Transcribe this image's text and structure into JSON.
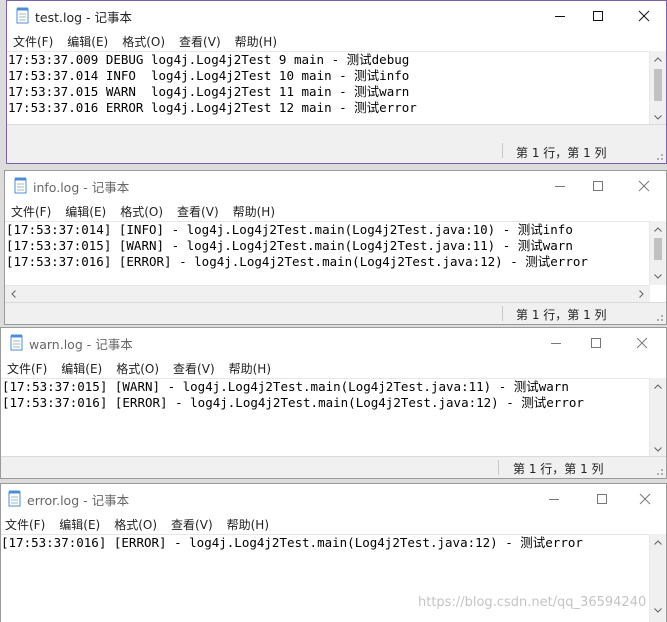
{
  "menu": [
    "文件(F)",
    "编辑(E)",
    "格式(O)",
    "查看(V)",
    "帮助(H)"
  ],
  "status_position": "第 1 行，第 1 列",
  "windows": [
    {
      "title": "test.log - 记事本",
      "lines": [
        "17:53:37.009 DEBUG log4j.Log4j2Test 9 main - 测试debug",
        "17:53:37.014 INFO  log4j.Log4j2Test 10 main - 测试info",
        "17:53:37.015 WARN  log4j.Log4j2Test 11 main - 测试warn",
        "17:53:37.016 ERROR log4j.Log4j2Test 12 main - 测试error"
      ]
    },
    {
      "title": "info.log - 记事本",
      "lines": [
        "[17:53:37:014] [INFO] - log4j.Log4j2Test.main(Log4j2Test.java:10) - 测试info",
        "[17:53:37:015] [WARN] - log4j.Log4j2Test.main(Log4j2Test.java:11) - 测试warn",
        "[17:53:37:016] [ERROR] - log4j.Log4j2Test.main(Log4j2Test.java:12) - 测试error"
      ]
    },
    {
      "title": "warn.log - 记事本",
      "lines": [
        "[17:53:37:015] [WARN] - log4j.Log4j2Test.main(Log4j2Test.java:11) - 测试warn",
        "[17:53:37:016] [ERROR] - log4j.Log4j2Test.main(Log4j2Test.java:12) - 测试error"
      ]
    },
    {
      "title": "error.log - 记事本",
      "lines": [
        "[17:53:37:016] [ERROR] - log4j.Log4j2Test.main(Log4j2Test.java:12) - 测试error"
      ]
    }
  ],
  "watermark": "https://blog.csdn.net/qq_36594240"
}
